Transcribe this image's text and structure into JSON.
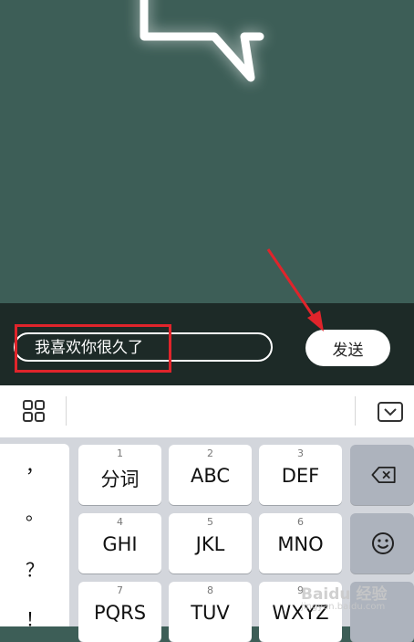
{
  "comment": {
    "value": "我喜欢你很久了"
  },
  "send": {
    "label": "发送"
  },
  "keyboard": {
    "punctuation": [
      "，",
      "。",
      "？",
      "！"
    ],
    "keys": [
      {
        "num": "1",
        "label": "分词"
      },
      {
        "num": "2",
        "label": "ABC"
      },
      {
        "num": "3",
        "label": "DEF"
      },
      {
        "num": "4",
        "label": "GHI"
      },
      {
        "num": "5",
        "label": "JKL"
      },
      {
        "num": "6",
        "label": "MNO"
      },
      {
        "num": "7",
        "label": "PQRS"
      },
      {
        "num": "8",
        "label": "TUV"
      },
      {
        "num": "9",
        "label": "WXYZ"
      }
    ]
  },
  "watermark": {
    "brand": "Baidu 经验",
    "url": "jingyan.baidu.com"
  },
  "colors": {
    "video_bg": "#3d5e57",
    "input_bar": "#1d2a27",
    "annotation_red": "#e0242b",
    "keyboard_bg": "#d3d6dc"
  },
  "icons": [
    "speech-bubble-icon",
    "grid-icon",
    "keyboard-collapse-icon",
    "backspace-icon",
    "emoji-icon",
    "annotation-arrow-icon"
  ]
}
